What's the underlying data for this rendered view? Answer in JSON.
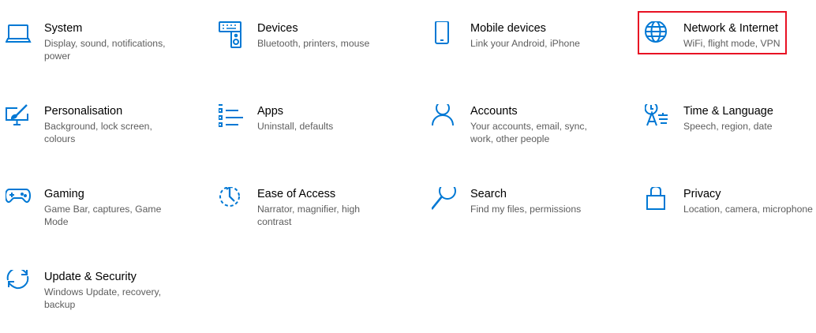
{
  "accent_color": "#0078d4",
  "highlight_color": "#e81123",
  "tiles": [
    {
      "id": "system",
      "icon": "laptop-icon",
      "title": "System",
      "description": "Display, sound, notifications, power"
    },
    {
      "id": "devices",
      "icon": "keyboard-speaker-icon",
      "title": "Devices",
      "description": "Bluetooth, printers, mouse"
    },
    {
      "id": "mobile",
      "icon": "phone-icon",
      "title": "Mobile devices",
      "description": "Link your Android, iPhone"
    },
    {
      "id": "network",
      "icon": "globe-icon",
      "title": "Network & Internet",
      "description": "WiFi, flight mode, VPN",
      "highlighted": true
    },
    {
      "id": "personalisation",
      "icon": "paint-monitor-icon",
      "title": "Personalisation",
      "description": "Background, lock screen, colours"
    },
    {
      "id": "apps",
      "icon": "app-list-icon",
      "title": "Apps",
      "description": "Uninstall, defaults"
    },
    {
      "id": "accounts",
      "icon": "person-icon",
      "title": "Accounts",
      "description": "Your accounts, email, sync, work, other people"
    },
    {
      "id": "time",
      "icon": "clock-language-icon",
      "title": "Time & Language",
      "description": "Speech, region, date"
    },
    {
      "id": "gaming",
      "icon": "gamepad-icon",
      "title": "Gaming",
      "description": "Game Bar, captures, Game Mode"
    },
    {
      "id": "ease",
      "icon": "ease-of-access-icon",
      "title": "Ease of Access",
      "description": "Narrator, magnifier, high contrast"
    },
    {
      "id": "search",
      "icon": "search-icon",
      "title": "Search",
      "description": "Find my files, permissions"
    },
    {
      "id": "privacy",
      "icon": "lock-icon",
      "title": "Privacy",
      "description": "Location, camera, microphone"
    },
    {
      "id": "update",
      "icon": "sync-icon",
      "title": "Update & Security",
      "description": "Windows Update, recovery, backup"
    }
  ]
}
